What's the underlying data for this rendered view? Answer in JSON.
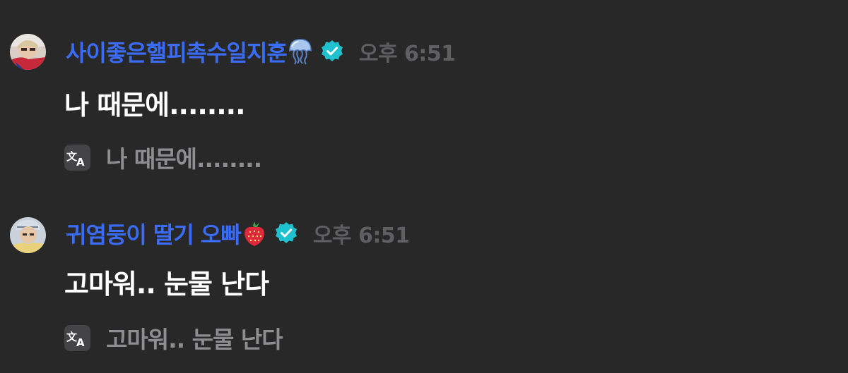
{
  "messages": [
    {
      "username": "사이좋은핼피촉수일지훈",
      "name_emoji": "jellyfish-emoji",
      "verified_icon": "verified-badge-icon",
      "time": "오후 6:51",
      "text": "나 때문에........",
      "translation": "나 때문에........",
      "translate_icon": "translate-icon"
    },
    {
      "username": "귀염둥이 딸기 오빠",
      "name_emoji": "strawberry-emoji",
      "verified_icon": "verified-badge-icon",
      "time": "오후 6:51",
      "text": "고마워.. 눈물 난다",
      "translation": "고마워.. 눈물 난다",
      "translate_icon": "translate-icon"
    }
  ],
  "colors": {
    "background": "#282829",
    "username": "#3b6cf6",
    "verified": "#1fc1cf",
    "time": "#5f5f62",
    "message_text": "#ffffff",
    "translation_text": "#8e8e91",
    "translate_icon_bg": "#444447"
  }
}
